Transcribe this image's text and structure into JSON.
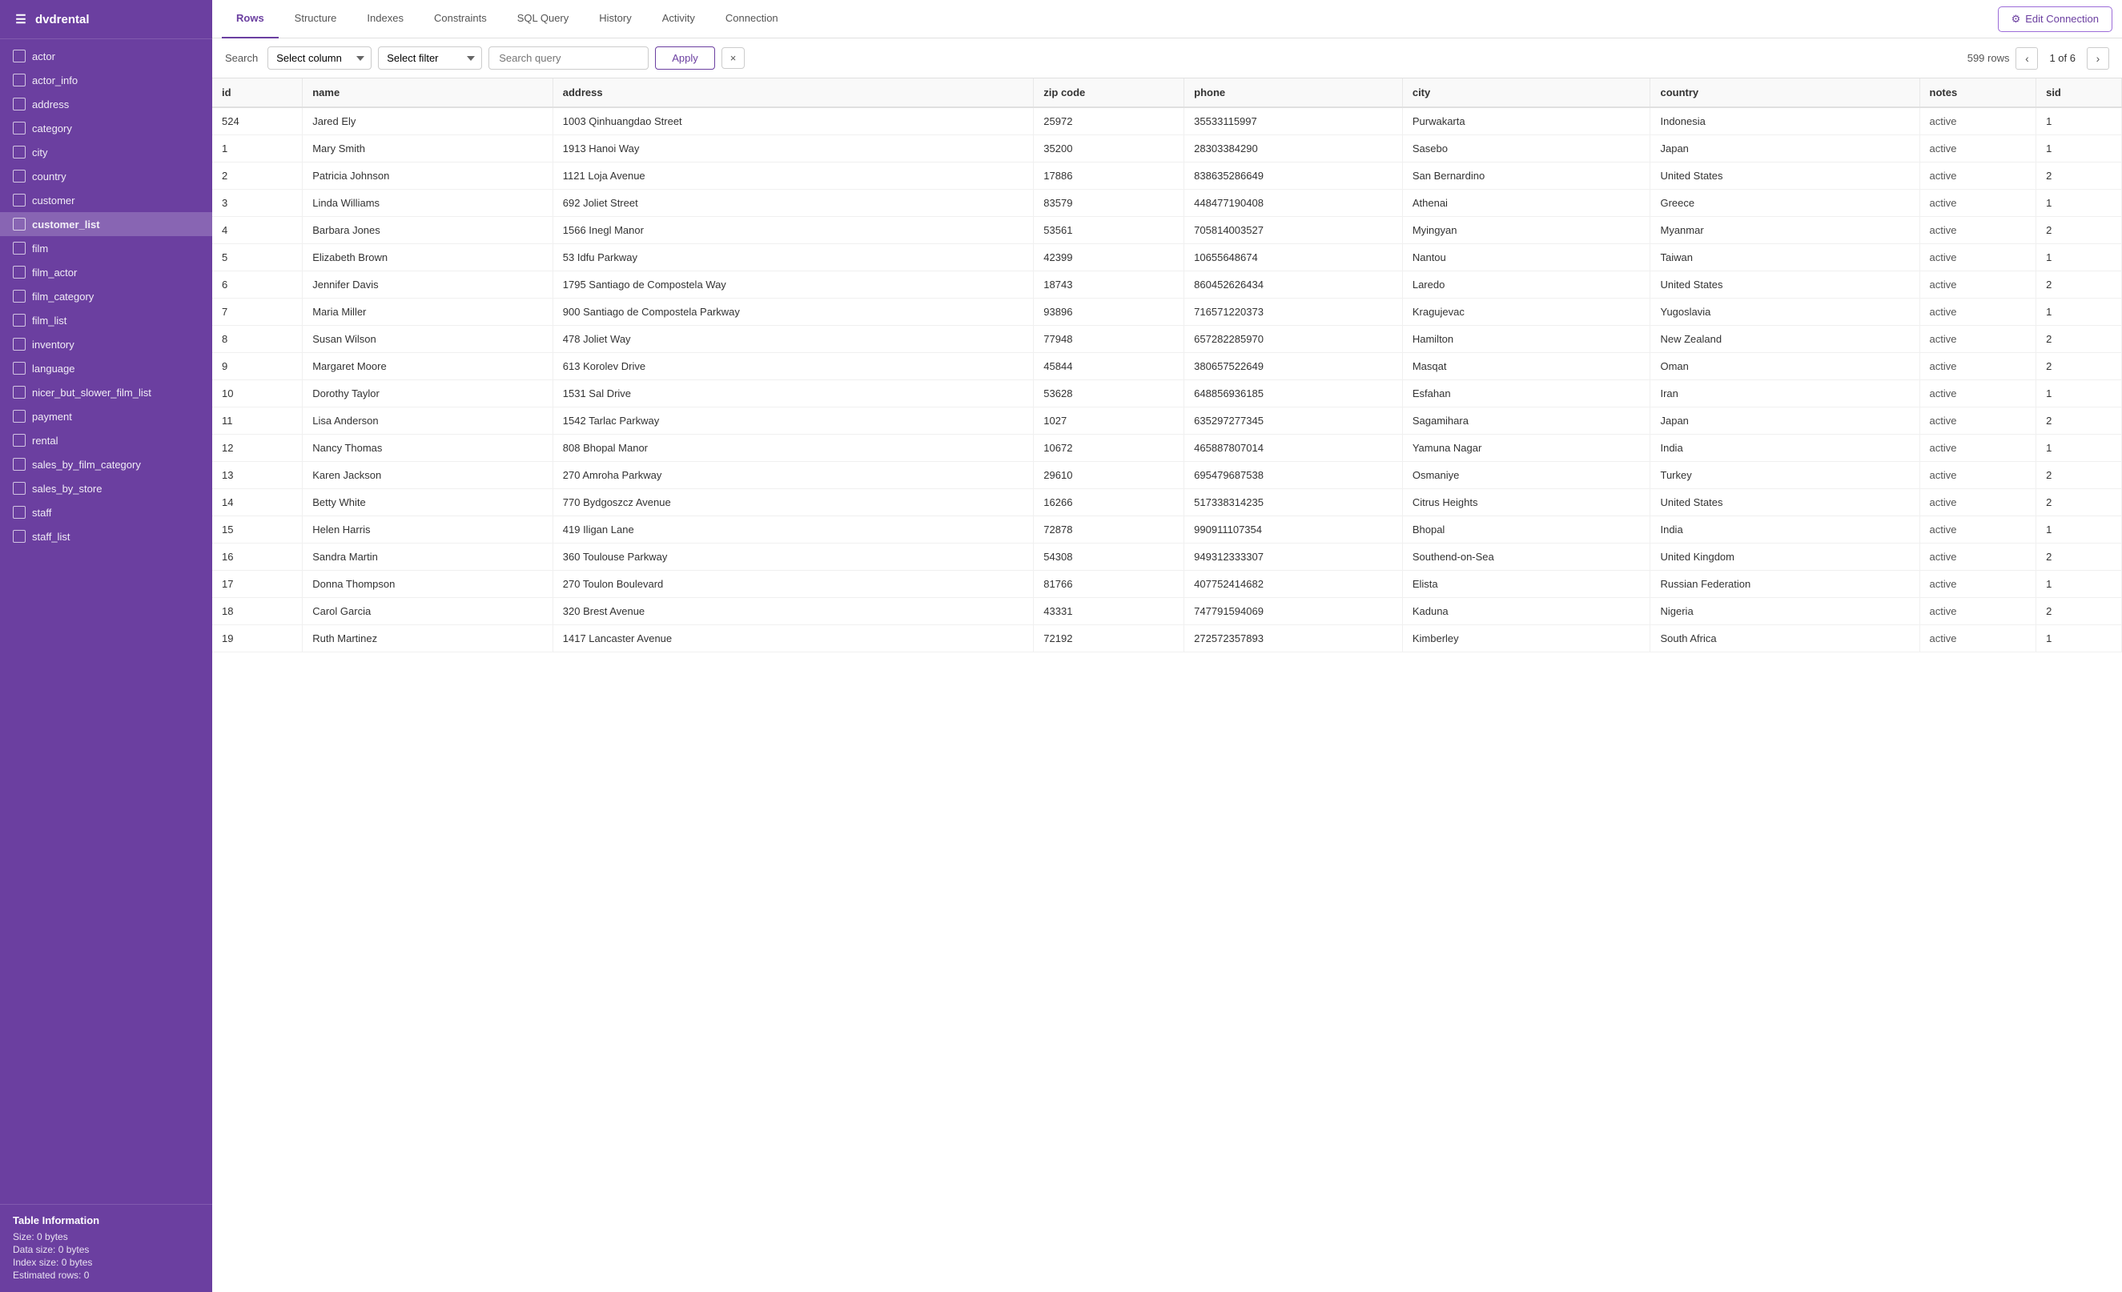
{
  "app": {
    "title": "dvdrental",
    "db_icon": "☰"
  },
  "sidebar": {
    "items": [
      {
        "label": "actor",
        "icon": "⊞"
      },
      {
        "label": "actor_info",
        "icon": "⊞"
      },
      {
        "label": "address",
        "icon": "⊞"
      },
      {
        "label": "category",
        "icon": "⊞"
      },
      {
        "label": "city",
        "icon": "⊞"
      },
      {
        "label": "country",
        "icon": "⊞"
      },
      {
        "label": "customer",
        "icon": "⊞"
      },
      {
        "label": "customer_list",
        "icon": "⊞",
        "active": true
      },
      {
        "label": "film",
        "icon": "⊞"
      },
      {
        "label": "film_actor",
        "icon": "⊞"
      },
      {
        "label": "film_category",
        "icon": "⊞"
      },
      {
        "label": "film_list",
        "icon": "⊞"
      },
      {
        "label": "inventory",
        "icon": "⊞"
      },
      {
        "label": "language",
        "icon": "⊞"
      },
      {
        "label": "nicer_but_slower_film_list",
        "icon": "⊞"
      },
      {
        "label": "payment",
        "icon": "⊞"
      },
      {
        "label": "rental",
        "icon": "⊞"
      },
      {
        "label": "sales_by_film_category",
        "icon": "⊞"
      },
      {
        "label": "sales_by_store",
        "icon": "⊞"
      },
      {
        "label": "staff",
        "icon": "⊞"
      },
      {
        "label": "staff_list",
        "icon": "⊞"
      }
    ],
    "table_info": {
      "heading": "Table Information",
      "size": "Size: 0 bytes",
      "data_size": "Data size: 0 bytes",
      "index_size": "Index size: 0 bytes",
      "estimated_rows": "Estimated rows: 0"
    }
  },
  "nav": {
    "tabs": [
      {
        "label": "Rows",
        "active": true
      },
      {
        "label": "Structure"
      },
      {
        "label": "Indexes"
      },
      {
        "label": "Constraints"
      },
      {
        "label": "SQL Query"
      },
      {
        "label": "History"
      },
      {
        "label": "Activity"
      },
      {
        "label": "Connection"
      }
    ],
    "edit_connection": "Edit Connection"
  },
  "toolbar": {
    "search_label": "Search",
    "select_column_placeholder": "Select column",
    "select_filter_placeholder": "Select filter",
    "search_placeholder": "Search query",
    "apply_label": "Apply",
    "clear_label": "×",
    "row_count": "599 rows",
    "page_current": "1 of 6",
    "page_of": "of 6"
  },
  "table": {
    "columns": [
      "id",
      "name",
      "address",
      "zip code",
      "phone",
      "city",
      "country",
      "notes",
      "sid"
    ],
    "rows": [
      {
        "id": "524",
        "name": "Jared Ely",
        "address": "1003 Qinhuangdao Street",
        "zip_code": "25972",
        "phone": "35533115997",
        "city": "Purwakarta",
        "country": "Indonesia",
        "notes": "active",
        "sid": "1"
      },
      {
        "id": "1",
        "name": "Mary Smith",
        "address": "1913 Hanoi Way",
        "zip_code": "35200",
        "phone": "28303384290",
        "city": "Sasebo",
        "country": "Japan",
        "notes": "active",
        "sid": "1"
      },
      {
        "id": "2",
        "name": "Patricia Johnson",
        "address": "1121 Loja Avenue",
        "zip_code": "17886",
        "phone": "838635286649",
        "city": "San Bernardino",
        "country": "United States",
        "notes": "active",
        "sid": "2"
      },
      {
        "id": "3",
        "name": "Linda Williams",
        "address": "692 Joliet Street",
        "zip_code": "83579",
        "phone": "448477190408",
        "city": "Athenai",
        "country": "Greece",
        "notes": "active",
        "sid": "1"
      },
      {
        "id": "4",
        "name": "Barbara Jones",
        "address": "1566 Inegl Manor",
        "zip_code": "53561",
        "phone": "705814003527",
        "city": "Myingyan",
        "country": "Myanmar",
        "notes": "active",
        "sid": "2"
      },
      {
        "id": "5",
        "name": "Elizabeth Brown",
        "address": "53 Idfu Parkway",
        "zip_code": "42399",
        "phone": "10655648674",
        "city": "Nantou",
        "country": "Taiwan",
        "notes": "active",
        "sid": "1"
      },
      {
        "id": "6",
        "name": "Jennifer Davis",
        "address": "1795 Santiago de Compostela Way",
        "zip_code": "18743",
        "phone": "860452626434",
        "city": "Laredo",
        "country": "United States",
        "notes": "active",
        "sid": "2"
      },
      {
        "id": "7",
        "name": "Maria Miller",
        "address": "900 Santiago de Compostela Parkway",
        "zip_code": "93896",
        "phone": "716571220373",
        "city": "Kragujevac",
        "country": "Yugoslavia",
        "notes": "active",
        "sid": "1"
      },
      {
        "id": "8",
        "name": "Susan Wilson",
        "address": "478 Joliet Way",
        "zip_code": "77948",
        "phone": "657282285970",
        "city": "Hamilton",
        "country": "New Zealand",
        "notes": "active",
        "sid": "2"
      },
      {
        "id": "9",
        "name": "Margaret Moore",
        "address": "613 Korolev Drive",
        "zip_code": "45844",
        "phone": "380657522649",
        "city": "Masqat",
        "country": "Oman",
        "notes": "active",
        "sid": "2"
      },
      {
        "id": "10",
        "name": "Dorothy Taylor",
        "address": "1531 Sal Drive",
        "zip_code": "53628",
        "phone": "648856936185",
        "city": "Esfahan",
        "country": "Iran",
        "notes": "active",
        "sid": "1"
      },
      {
        "id": "11",
        "name": "Lisa Anderson",
        "address": "1542 Tarlac Parkway",
        "zip_code": "1027",
        "phone": "635297277345",
        "city": "Sagamihara",
        "country": "Japan",
        "notes": "active",
        "sid": "2"
      },
      {
        "id": "12",
        "name": "Nancy Thomas",
        "address": "808 Bhopal Manor",
        "zip_code": "10672",
        "phone": "465887807014",
        "city": "Yamuna Nagar",
        "country": "India",
        "notes": "active",
        "sid": "1"
      },
      {
        "id": "13",
        "name": "Karen Jackson",
        "address": "270 Amroha Parkway",
        "zip_code": "29610",
        "phone": "695479687538",
        "city": "Osmaniye",
        "country": "Turkey",
        "notes": "active",
        "sid": "2"
      },
      {
        "id": "14",
        "name": "Betty White",
        "address": "770 Bydgoszcz Avenue",
        "zip_code": "16266",
        "phone": "517338314235",
        "city": "Citrus Heights",
        "country": "United States",
        "notes": "active",
        "sid": "2"
      },
      {
        "id": "15",
        "name": "Helen Harris",
        "address": "419 Iligan Lane",
        "zip_code": "72878",
        "phone": "990911107354",
        "city": "Bhopal",
        "country": "India",
        "notes": "active",
        "sid": "1"
      },
      {
        "id": "16",
        "name": "Sandra Martin",
        "address": "360 Toulouse Parkway",
        "zip_code": "54308",
        "phone": "949312333307",
        "city": "Southend-on-Sea",
        "country": "United Kingdom",
        "notes": "active",
        "sid": "2"
      },
      {
        "id": "17",
        "name": "Donna Thompson",
        "address": "270 Toulon Boulevard",
        "zip_code": "81766",
        "phone": "407752414682",
        "city": "Elista",
        "country": "Russian Federation",
        "notes": "active",
        "sid": "1"
      },
      {
        "id": "18",
        "name": "Carol Garcia",
        "address": "320 Brest Avenue",
        "zip_code": "43331",
        "phone": "747791594069",
        "city": "Kaduna",
        "country": "Nigeria",
        "notes": "active",
        "sid": "2"
      },
      {
        "id": "19",
        "name": "Ruth Martinez",
        "address": "1417 Lancaster Avenue",
        "zip_code": "72192",
        "phone": "272572357893",
        "city": "Kimberley",
        "country": "South Africa",
        "notes": "active",
        "sid": "1"
      }
    ]
  }
}
